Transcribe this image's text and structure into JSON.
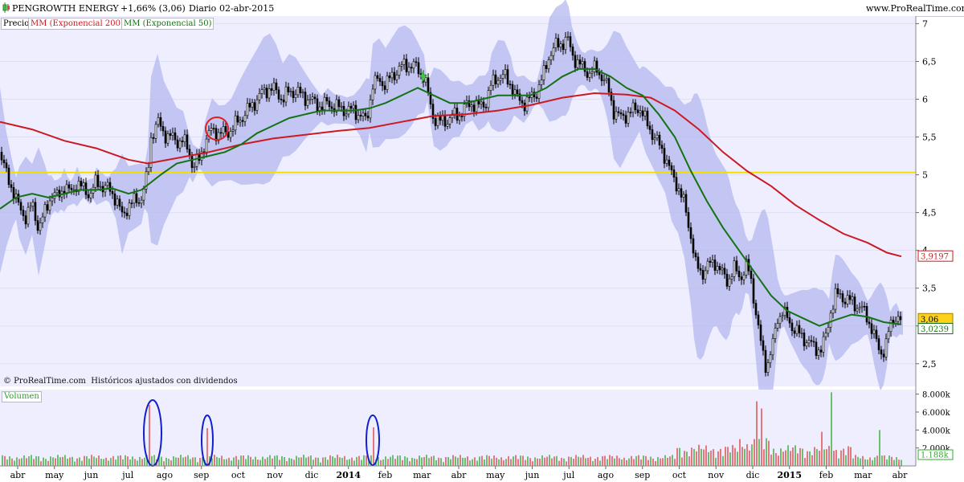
{
  "header": {
    "symbol": "PENGROWTH ENERGY",
    "change": "+1,66% (3,06)",
    "period": "Diario",
    "date": "02-abr-2015",
    "site": "www.ProRealTime.com"
  },
  "legend": {
    "price": "Precio",
    "ma200": "MM (Exponencial 200)",
    "ma50": "MM (Exponencial 50)"
  },
  "footer": {
    "copyright": "© ProRealTime.com",
    "note": "Históricos ajustados con dividendos"
  },
  "colors": {
    "background": "#eeeeff",
    "ma200": "#cc1a22",
    "ma50": "#147214",
    "band": "#b4b8ee",
    "support": "#f0e000",
    "volume_up": "#33aa33",
    "volume_down": "#dd4444",
    "circle_red": "#e02020",
    "circle_blue": "#1020cc"
  },
  "chart_data": [
    {
      "type": "line",
      "title": "",
      "x_ticks": [
        "abr",
        "may",
        "jun",
        "jul",
        "ago",
        "sep",
        "oct",
        "nov",
        "dic",
        "2014",
        "feb",
        "mar",
        "abr",
        "may",
        "jun",
        "jul",
        "ago",
        "sep",
        "oct",
        "nov",
        "dic",
        "2015",
        "feb",
        "mar",
        "abr"
      ],
      "y_ticks": [
        2.5,
        3,
        3.5,
        4,
        4.5,
        5,
        5.5,
        6,
        6.5,
        7
      ],
      "ylim": [
        2.2,
        7.1
      ],
      "grid": true,
      "price_labels": {
        "last": "3,06",
        "ma200": "3,9197",
        "ma50": "3,0239"
      },
      "support_level": 5.03,
      "series": [
        {
          "name": "Precio",
          "style": "candles",
          "points": [
            [
              0,
              5.3
            ],
            [
              8,
              5.0
            ],
            [
              16,
              4.8
            ],
            [
              24,
              4.55
            ],
            [
              32,
              4.45
            ],
            [
              40,
              4.6
            ],
            [
              48,
              4.3
            ],
            [
              56,
              4.5
            ],
            [
              64,
              4.75
            ],
            [
              72,
              4.7
            ],
            [
              80,
              4.85
            ],
            [
              88,
              4.75
            ],
            [
              96,
              4.9
            ],
            [
              104,
              4.8
            ],
            [
              112,
              4.75
            ],
            [
              120,
              4.9
            ],
            [
              128,
              4.85
            ],
            [
              136,
              4.8
            ],
            [
              144,
              4.7
            ],
            [
              152,
              4.45
            ],
            [
              160,
              4.6
            ],
            [
              168,
              4.65
            ],
            [
              176,
              4.7
            ],
            [
              184,
              5.0
            ],
            [
              188,
              5.5
            ],
            [
              196,
              5.7
            ],
            [
              204,
              5.55
            ],
            [
              212,
              5.5
            ],
            [
              220,
              5.45
            ],
            [
              228,
              5.45
            ],
            [
              236,
              5.3
            ],
            [
              240,
              5.1
            ],
            [
              248,
              5.2
            ],
            [
              256,
              5.45
            ],
            [
              264,
              5.6
            ],
            [
              272,
              5.55
            ],
            [
              280,
              5.55
            ],
            [
              288,
              5.6
            ],
            [
              296,
              5.7
            ],
            [
              304,
              5.8
            ],
            [
              312,
              5.9
            ],
            [
              320,
              6.0
            ],
            [
              328,
              6.1
            ],
            [
              336,
              6.15
            ],
            [
              344,
              6.1
            ],
            [
              352,
              6.0
            ],
            [
              360,
              6.1
            ],
            [
              368,
              6.1
            ],
            [
              376,
              6.05
            ],
            [
              384,
              6.0
            ],
            [
              392,
              5.95
            ],
            [
              400,
              5.9
            ],
            [
              408,
              5.95
            ],
            [
              416,
              5.9
            ],
            [
              424,
              5.88
            ],
            [
              432,
              5.85
            ],
            [
              440,
              5.85
            ],
            [
              448,
              5.8
            ],
            [
              456,
              5.7
            ],
            [
              464,
              6.2
            ],
            [
              472,
              6.25
            ],
            [
              480,
              6.2
            ],
            [
              488,
              6.3
            ],
            [
              496,
              6.4
            ],
            [
              504,
              6.45
            ],
            [
              512,
              6.45
            ],
            [
              520,
              6.4
            ],
            [
              528,
              6.3
            ],
            [
              534,
              6.0
            ],
            [
              540,
              5.75
            ],
            [
              548,
              5.7
            ],
            [
              556,
              5.72
            ],
            [
              564,
              5.78
            ],
            [
              572,
              5.8
            ],
            [
              580,
              5.9
            ],
            [
              588,
              5.95
            ],
            [
              596,
              5.9
            ],
            [
              604,
              5.95
            ],
            [
              612,
              6.2
            ],
            [
              620,
              6.3
            ],
            [
              628,
              6.3
            ],
            [
              636,
              6.2
            ],
            [
              644,
              6.0
            ],
            [
              652,
              5.95
            ],
            [
              660,
              6.0
            ],
            [
              668,
              6.1
            ],
            [
              676,
              6.3
            ],
            [
              684,
              6.6
            ],
            [
              692,
              6.7
            ],
            [
              700,
              6.75
            ],
            [
              706,
              6.8
            ],
            [
              712,
              6.6
            ],
            [
              718,
              6.5
            ],
            [
              726,
              6.4
            ],
            [
              734,
              6.35
            ],
            [
              742,
              6.4
            ],
            [
              750,
              6.3
            ],
            [
              758,
              6.1
            ],
            [
              764,
              5.85
            ],
            [
              772,
              5.75
            ],
            [
              780,
              5.8
            ],
            [
              788,
              5.85
            ],
            [
              796,
              5.9
            ],
            [
              804,
              5.7
            ],
            [
              812,
              5.55
            ],
            [
              820,
              5.4
            ],
            [
              828,
              5.25
            ],
            [
              836,
              5.0
            ],
            [
              844,
              4.85
            ],
            [
              852,
              4.6
            ],
            [
              860,
              4.2
            ],
            [
              866,
              3.8
            ],
            [
              874,
              3.7
            ],
            [
              882,
              3.8
            ],
            [
              890,
              3.85
            ],
            [
              898,
              3.7
            ],
            [
              906,
              3.6
            ],
            [
              914,
              3.75
            ],
            [
              922,
              3.65
            ],
            [
              930,
              3.8
            ],
            [
              936,
              3.55
            ],
            [
              942,
              3.1
            ],
            [
              948,
              2.7
            ],
            [
              954,
              2.45
            ],
            [
              962,
              2.75
            ],
            [
              968,
              3.1
            ],
            [
              974,
              3.2
            ],
            [
              982,
              3.05
            ],
            [
              990,
              2.95
            ],
            [
              998,
              2.85
            ],
            [
              1006,
              2.8
            ],
            [
              1014,
              2.7
            ],
            [
              1022,
              2.7
            ],
            [
              1028,
              2.85
            ],
            [
              1034,
              3.2
            ],
            [
              1040,
              3.4
            ],
            [
              1046,
              3.4
            ],
            [
              1054,
              3.35
            ],
            [
              1062,
              3.3
            ],
            [
              1070,
              3.25
            ],
            [
              1078,
              3.15
            ],
            [
              1084,
              3.0
            ],
            [
              1090,
              2.8
            ],
            [
              1096,
              2.65
            ],
            [
              1102,
              2.7
            ],
            [
              1108,
              3.0
            ],
            [
              1114,
              3.15
            ],
            [
              1120,
              3.06
            ]
          ]
        },
        {
          "name": "MM (Exponencial 200)",
          "points": [
            [
              0,
              5.7
            ],
            [
              40,
              5.6
            ],
            [
              80,
              5.45
            ],
            [
              120,
              5.35
            ],
            [
              160,
              5.2
            ],
            [
              184,
              5.15
            ],
            [
              220,
              5.22
            ],
            [
              260,
              5.3
            ],
            [
              300,
              5.4
            ],
            [
              340,
              5.48
            ],
            [
              380,
              5.53
            ],
            [
              420,
              5.58
            ],
            [
              460,
              5.62
            ],
            [
              500,
              5.7
            ],
            [
              540,
              5.78
            ],
            [
              580,
              5.8
            ],
            [
              620,
              5.85
            ],
            [
              660,
              5.92
            ],
            [
              700,
              6.02
            ],
            [
              740,
              6.08
            ],
            [
              780,
              6.06
            ],
            [
              810,
              6.02
            ],
            [
              840,
              5.85
            ],
            [
              870,
              5.6
            ],
            [
              900,
              5.3
            ],
            [
              930,
              5.05
            ],
            [
              960,
              4.85
            ],
            [
              990,
              4.6
            ],
            [
              1020,
              4.4
            ],
            [
              1050,
              4.22
            ],
            [
              1080,
              4.1
            ],
            [
              1104,
              3.97
            ],
            [
              1122,
              3.92
            ]
          ]
        },
        {
          "name": "MM (Exponencial 50)",
          "points": [
            [
              0,
              4.55
            ],
            [
              20,
              4.7
            ],
            [
              40,
              4.75
            ],
            [
              60,
              4.7
            ],
            [
              80,
              4.75
            ],
            [
              100,
              4.8
            ],
            [
              120,
              4.8
            ],
            [
              140,
              4.82
            ],
            [
              160,
              4.75
            ],
            [
              176,
              4.8
            ],
            [
              200,
              5.0
            ],
            [
              220,
              5.15
            ],
            [
              240,
              5.2
            ],
            [
              260,
              5.25
            ],
            [
              280,
              5.3
            ],
            [
              300,
              5.4
            ],
            [
              320,
              5.55
            ],
            [
              340,
              5.65
            ],
            [
              360,
              5.75
            ],
            [
              380,
              5.8
            ],
            [
              400,
              5.85
            ],
            [
              420,
              5.85
            ],
            [
              440,
              5.85
            ],
            [
              460,
              5.88
            ],
            [
              480,
              5.95
            ],
            [
              500,
              6.05
            ],
            [
              520,
              6.15
            ],
            [
              540,
              6.05
            ],
            [
              560,
              5.95
            ],
            [
              580,
              5.95
            ],
            [
              600,
              6.0
            ],
            [
              620,
              6.05
            ],
            [
              640,
              6.05
            ],
            [
              660,
              6.05
            ],
            [
              680,
              6.15
            ],
            [
              700,
              6.3
            ],
            [
              720,
              6.4
            ],
            [
              740,
              6.4
            ],
            [
              760,
              6.3
            ],
            [
              780,
              6.15
            ],
            [
              800,
              6.05
            ],
            [
              820,
              5.8
            ],
            [
              840,
              5.5
            ],
            [
              860,
              5.05
            ],
            [
              880,
              4.65
            ],
            [
              900,
              4.3
            ],
            [
              920,
              4.0
            ],
            [
              940,
              3.7
            ],
            [
              960,
              3.4
            ],
            [
              980,
              3.2
            ],
            [
              1000,
              3.1
            ],
            [
              1020,
              3.0
            ],
            [
              1040,
              3.08
            ],
            [
              1060,
              3.15
            ],
            [
              1080,
              3.12
            ],
            [
              1100,
              3.05
            ],
            [
              1122,
              3.02
            ]
          ]
        }
      ]
    },
    {
      "type": "bar",
      "title": "Volumen",
      "y_ticks": [
        "2.000k",
        "4.000k",
        "6.000k",
        "8.000k"
      ],
      "ylim": [
        0,
        8500
      ],
      "last_label": "1.188k",
      "peaks": [
        [
          187,
          6800
        ],
        [
          258,
          4200
        ],
        [
          466,
          4300
        ],
        [
          942,
          7200
        ],
        [
          948,
          6400
        ],
        [
          1034,
          8200
        ],
        [
          1022,
          3800
        ],
        [
          1096,
          4000
        ]
      ]
    }
  ]
}
